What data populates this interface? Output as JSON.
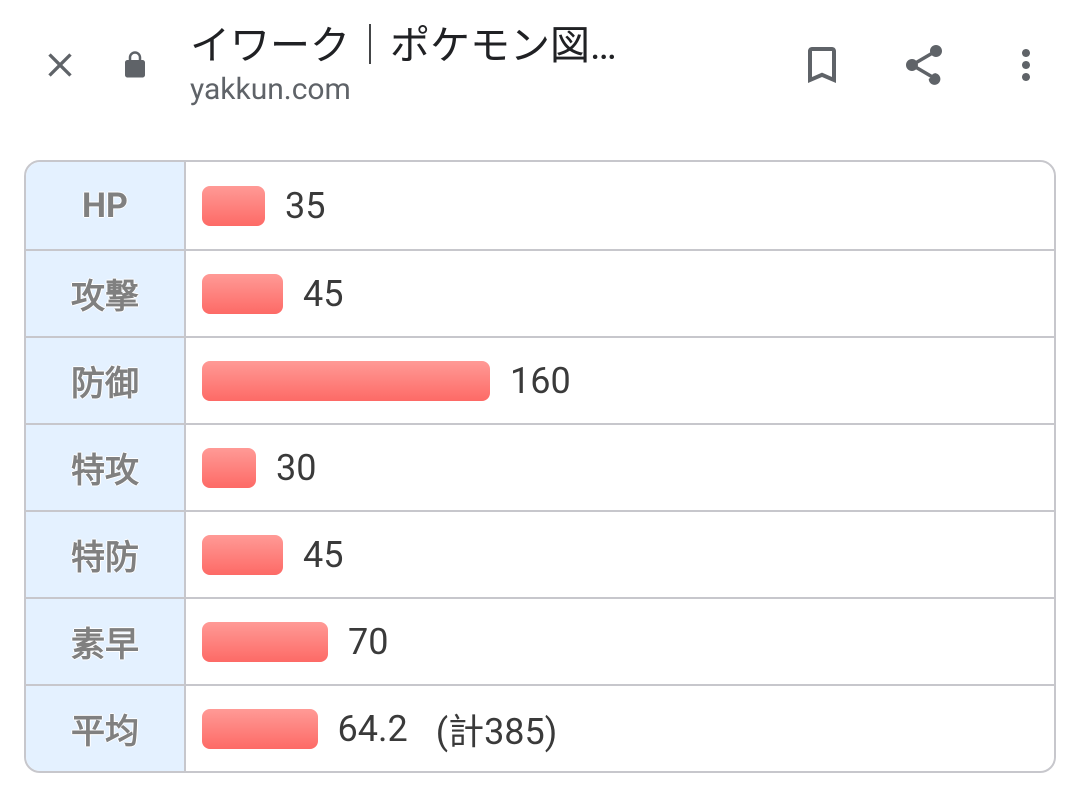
{
  "browser": {
    "title": "イワーク｜ポケモン図…",
    "host": "yakkun.com"
  },
  "chart_data": {
    "type": "bar",
    "max": 255,
    "stats": [
      {
        "label": "HP",
        "value": 35
      },
      {
        "label": "攻撃",
        "value": 45
      },
      {
        "label": "防御",
        "value": 160
      },
      {
        "label": "特攻",
        "value": 30
      },
      {
        "label": "特防",
        "value": 45
      },
      {
        "label": "素早",
        "value": 70
      },
      {
        "label": "平均",
        "value": 64.2,
        "extra": "(計385)"
      }
    ]
  }
}
